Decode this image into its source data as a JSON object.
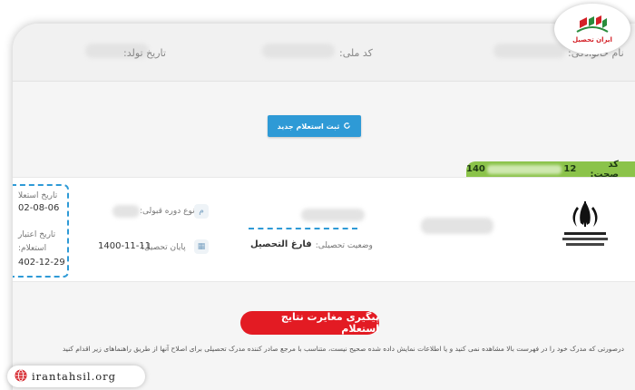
{
  "header": {
    "national_code_label": "کد ملی:",
    "birth_date_label": "تاریخ تولد:",
    "name_label": "نام خانوادگی:"
  },
  "actions": {
    "new_inquiry_label": "ثبت استعلام جدید",
    "follow_up_label": "پیگیری مغایرت نتایج استعلام"
  },
  "record": {
    "verification_code_label": "کد صحت:",
    "verification_code_start": "140",
    "verification_code_mid": "12",
    "course_type_label": "نوع دوره قبولی:",
    "graduation_label": "پایان تحصیل:",
    "graduation_date": "1400-11-11",
    "status_label": "وضعیت تحصیلی:",
    "status_value": "فارغ التحصیل",
    "issue_date_label": "تاریخ استعلا",
    "issue_date_value": "02-08-06",
    "validity_label_1": "تاریخ اعتبار",
    "validity_label_2": "استعلام:",
    "validity_date": "402-12-29"
  },
  "description": "درصورتی که مدرک خود را در فهرست بالا مشاهده نمی کنید و یا اطلاعات نمایش داده شده صحیح نیست، متناسب با مرجع صادر کننده مدرک تحصیلی برای اصلاح آنها از طریق راهنماهای زیر اقدام کنید",
  "branding": {
    "logo_text": "ایران تحصیل",
    "website": "irantahsil.org",
    "brand_color": "#d42027",
    "accent_blue": "#2e9ad6",
    "accent_green": "#8bc34a"
  }
}
